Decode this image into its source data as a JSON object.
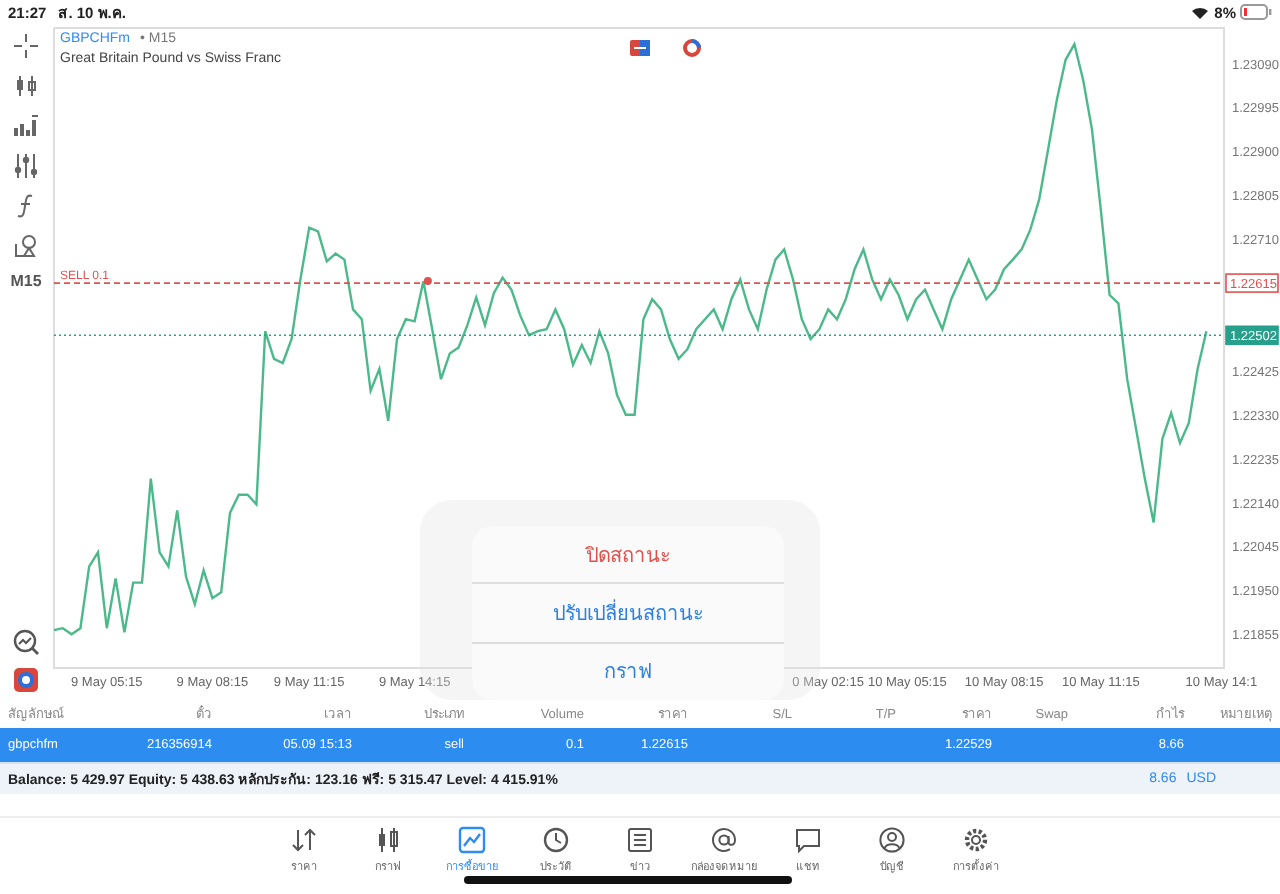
{
  "status_bar": {
    "time": "21:27",
    "date": "ส. 10 พ.ค.",
    "battery": "8%"
  },
  "toolbar": {
    "timeframe": "M15"
  },
  "chart": {
    "symbol": "GBPCHFm",
    "separator": "•",
    "timeframe": "M15",
    "description": "Great Britain Pound vs Swiss Franc",
    "order_label": "SELL 0.1",
    "chart_data": {
      "type": "line",
      "ylim": [
        1.21782,
        1.23167
      ],
      "categories": [
        null,
        null,
        null,
        null,
        null,
        null,
        "9 May 05:15",
        null,
        null,
        null,
        null,
        null,
        null,
        null,
        null,
        null,
        null,
        null,
        "9 May 08:15",
        null,
        null,
        null,
        null,
        null,
        null,
        null,
        null,
        null,
        null,
        "9 May 11:15",
        null,
        null,
        null,
        null,
        null,
        null,
        null,
        null,
        null,
        null,
        null,
        "9 May 14:15",
        null,
        null,
        null,
        null,
        null,
        null,
        null,
        null,
        null,
        null,
        null,
        null,
        null,
        null,
        null,
        null,
        null,
        null,
        null,
        null,
        null,
        null,
        null,
        null,
        null,
        null,
        null,
        null,
        null,
        null,
        null,
        null,
        null,
        null,
        null,
        null,
        null,
        null,
        null,
        null,
        null,
        null,
        null,
        null,
        null,
        null,
        "0 May 02:15",
        null,
        null,
        null,
        null,
        null,
        null,
        null,
        null,
        "10 May 05:15",
        null,
        null,
        null,
        null,
        null,
        null,
        null,
        null,
        null,
        null,
        "10 May 08:15",
        null,
        null,
        null,
        null,
        null,
        null,
        null,
        null,
        null,
        null,
        "10 May 11:15",
        null,
        null,
        null,
        null,
        null,
        null,
        null,
        null,
        null,
        null,
        null,
        null,
        null,
        "10 May 14:1"
      ],
      "yticks": [
        {
          "value": 1.2309,
          "label": "1.23090"
        },
        {
          "value": 1.22995,
          "label": "1.22995"
        },
        {
          "value": 1.229,
          "label": "1.22900"
        },
        {
          "value": 1.22805,
          "label": "1.22805"
        },
        {
          "value": 1.2271,
          "label": "1.22710"
        },
        {
          "value": 1.22425,
          "label": "1.22425"
        },
        {
          "value": 1.2233,
          "label": "1.22330"
        },
        {
          "value": 1.22235,
          "label": "1.22235"
        },
        {
          "value": 1.2214,
          "label": "1.22140"
        },
        {
          "value": 1.22045,
          "label": "1.22045"
        },
        {
          "value": 1.2195,
          "label": "1.21950"
        },
        {
          "value": 1.21855,
          "label": "1.21855"
        }
      ],
      "series": [
        {
          "color": "#4cb98a",
          "values": [
            1.21864,
            1.21868,
            1.21855,
            1.21868,
            1.22002,
            1.22032,
            1.21868,
            1.21976,
            1.21859,
            1.21967,
            1.21967,
            1.22192,
            1.22032,
            1.22002,
            1.22123,
            1.2198,
            1.2192,
            1.21993,
            1.21933,
            1.21946,
            1.22118,
            1.22157,
            1.22157,
            1.22136,
            1.22511,
            1.22451,
            1.22442,
            1.22494,
            1.22623,
            1.22735,
            1.22727,
            1.22662,
            1.22679,
            1.22666,
            1.22558,
            1.22537,
            1.22382,
            1.22429,
            1.22317,
            1.22494,
            1.22537,
            1.22532,
            1.22619,
            1.22515,
            1.22407,
            1.22463,
            1.22476,
            1.22524,
            1.22584,
            1.22524,
            1.22593,
            1.22627,
            1.22601,
            1.22545,
            1.22502,
            1.22511,
            1.22515,
            1.22558,
            1.22515,
            1.22438,
            1.22481,
            1.22442,
            1.22511,
            1.22463,
            1.22373,
            1.2233,
            1.2233,
            1.22537,
            1.2258,
            1.22558,
            1.22494,
            1.22451,
            1.22472,
            1.22515,
            1.22537,
            1.22558,
            1.22515,
            1.2258,
            1.22623,
            1.22558,
            1.22515,
            1.22601,
            1.22666,
            1.22688,
            1.22623,
            1.22537,
            1.22494,
            1.22515,
            1.22558,
            1.22537,
            1.2258,
            1.22645,
            1.22688,
            1.22623,
            1.2258,
            1.22623,
            1.22589,
            1.22537,
            1.2258,
            1.22601,
            1.22558,
            1.22515,
            1.2258,
            1.22623,
            1.22666,
            1.22623,
            1.2258,
            1.22601,
            1.22645,
            1.22666,
            1.22688,
            1.22731,
            1.22796,
            1.22903,
            1.23011,
            1.23098,
            1.23132,
            1.23054,
            1.22947,
            1.22774,
            1.22589,
            1.22571,
            1.22407,
            1.223,
            1.22192,
            1.22097,
            1.22278,
            1.22334,
            1.22269,
            1.22312,
            1.22429,
            1.22511,
            null,
            null
          ]
        }
      ],
      "ref_lines": [
        {
          "axis": "y",
          "value": 1.22615,
          "label": "1.22615"
        },
        {
          "axis": "y",
          "value": 1.22502,
          "label": "1.22502"
        }
      ]
    }
  },
  "table": {
    "columns": [
      "สัญลักษณ์",
      "ตั๋ว",
      "เวลา",
      "ประเภท",
      "Volume",
      "ราคา",
      "S/L",
      "T/P",
      "ราคา",
      "Swap",
      "กำไร",
      "หมายเหตุ"
    ],
    "rows": [
      {
        "selected": true,
        "symbol": "gbpchfm",
        "ticket": "216356914",
        "time": "05.09 15:13",
        "type": "sell",
        "volume": "0.1",
        "open_price": "1.22615",
        "current_price": "1.22529",
        "profit": "8.66"
      }
    ]
  },
  "summary": {
    "text": "Balance: 5 429.97 Equity: 5 438.63 หลักประกัน: 123.16 ฟรี: 5 315.47 Level: 4 415.91%",
    "profit": "8.66",
    "currency": "USD"
  },
  "tabs": [
    {
      "kind": "quotes",
      "label": "ราคา",
      "selected": false
    },
    {
      "kind": "chart",
      "label": "กราฟ",
      "selected": false
    },
    {
      "kind": "trade",
      "label": "การซื้อขาย",
      "selected": true
    },
    {
      "kind": "history",
      "label": "ประวัติ",
      "selected": false
    },
    {
      "kind": "news",
      "label": "ข่าว",
      "selected": false
    },
    {
      "kind": "mail",
      "label": "กล่องจดหมาย",
      "selected": false
    },
    {
      "kind": "chat",
      "label": "แชท",
      "selected": false
    },
    {
      "kind": "account",
      "label": "บัญชี",
      "selected": false
    },
    {
      "kind": "settings",
      "label": "การตั้งค่า",
      "selected": false
    }
  ],
  "popup": {
    "items": [
      {
        "kind": "destructive",
        "label": "ปิดสถานะ"
      },
      {
        "kind": "normal",
        "label": "ปรับเปลี่ยนสถานะ"
      },
      {
        "kind": "normal",
        "label": "กราฟ"
      }
    ]
  }
}
